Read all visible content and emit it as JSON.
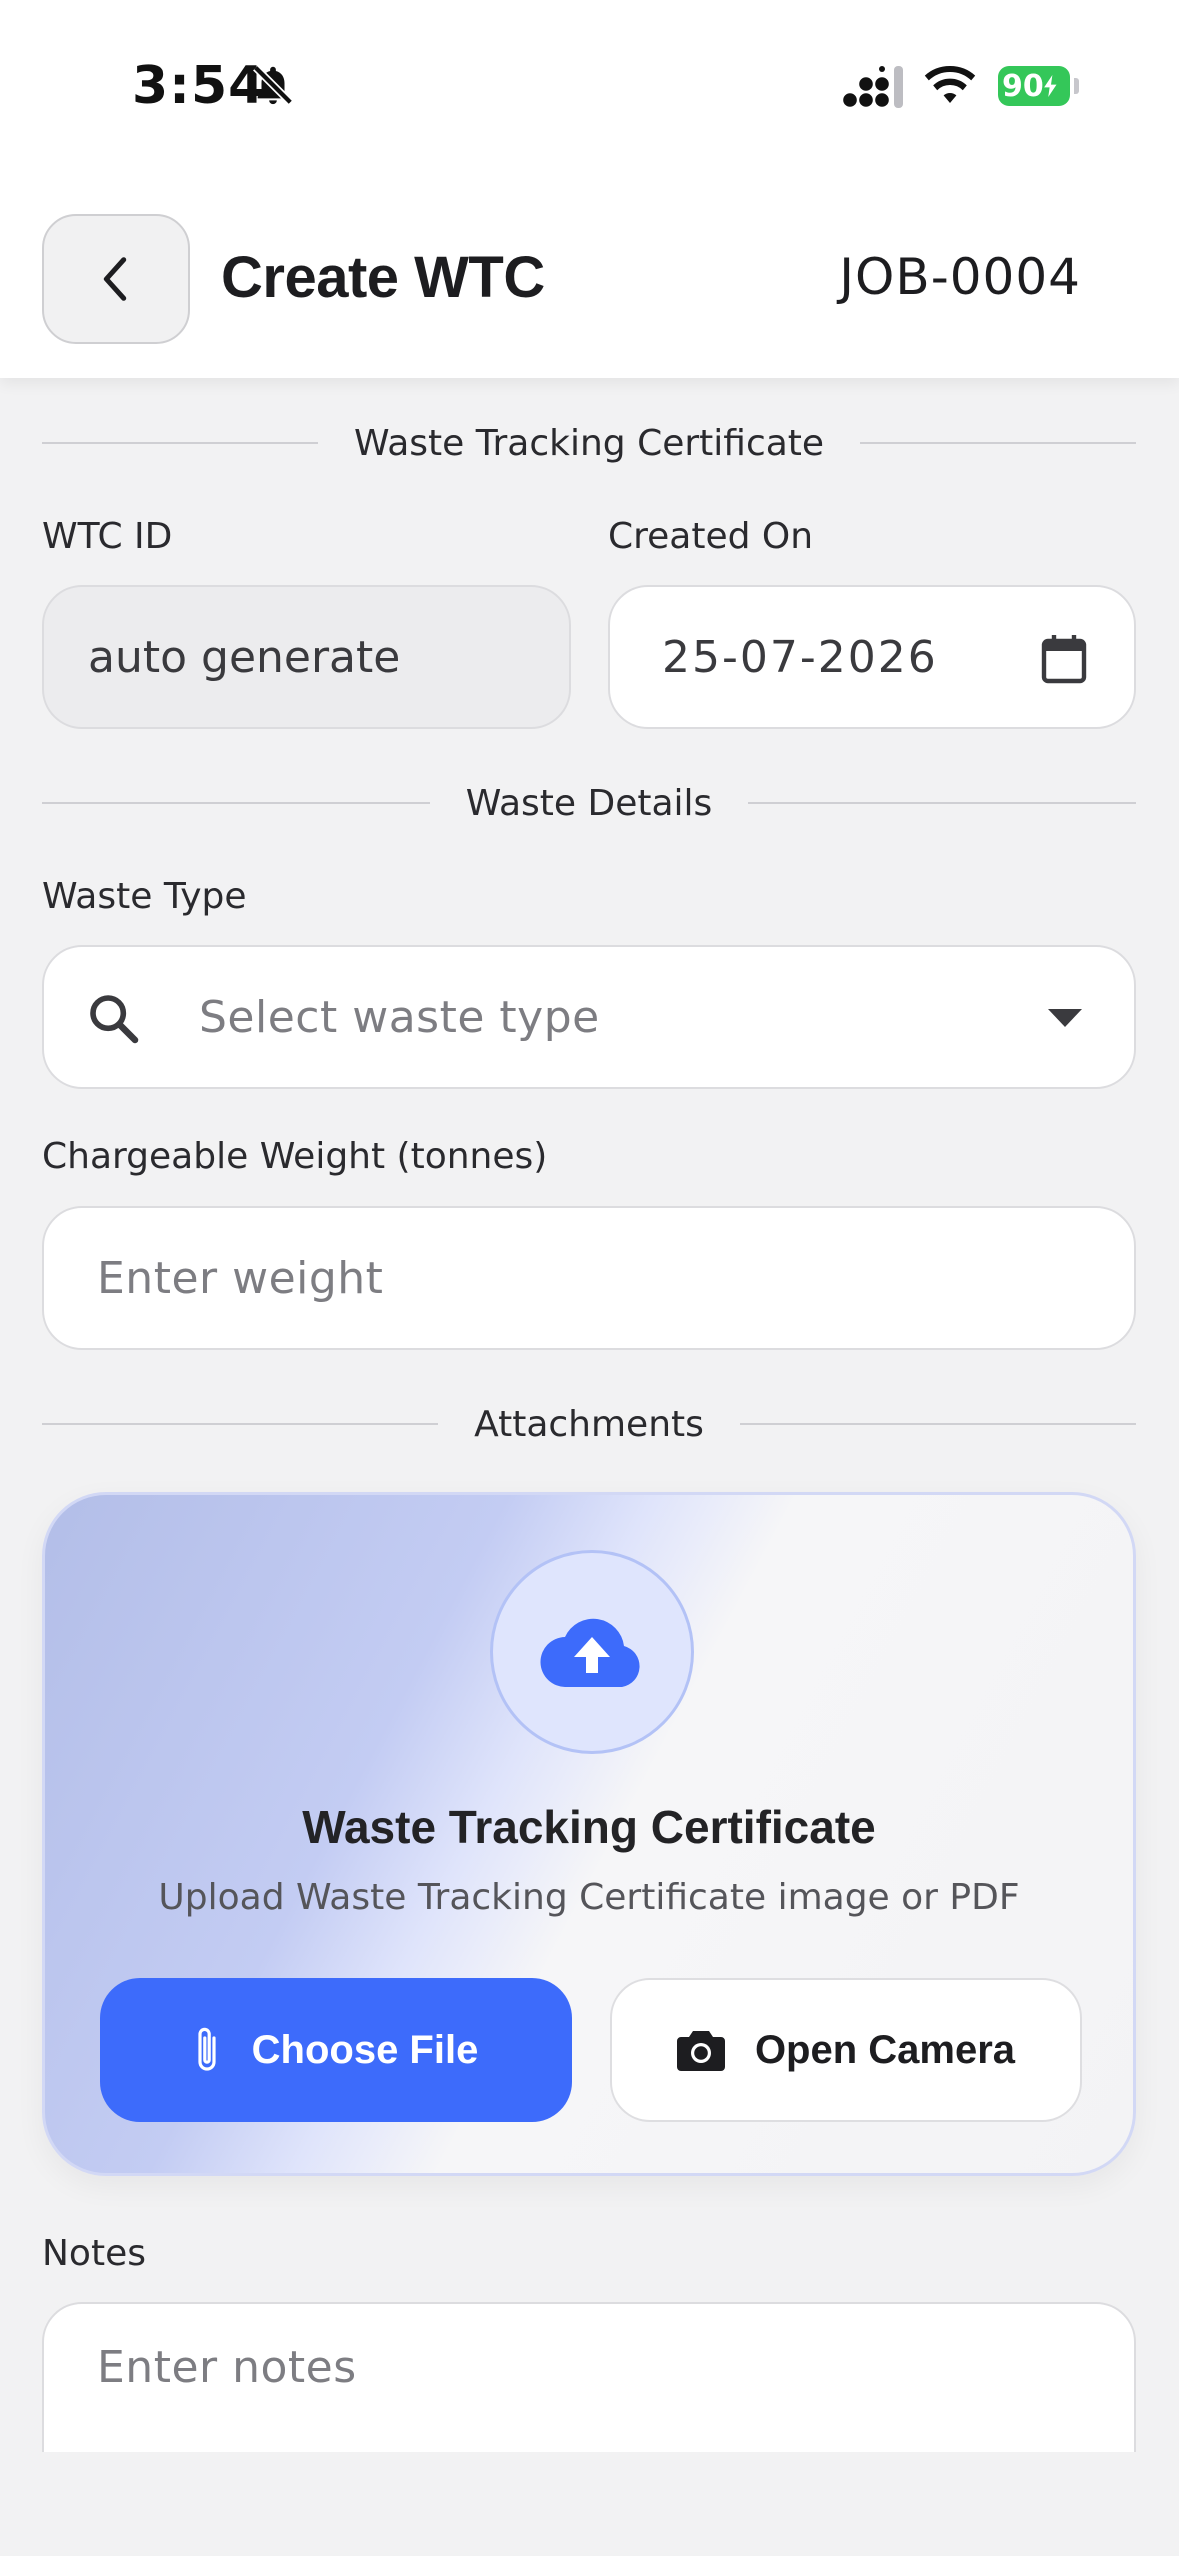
{
  "status_bar": {
    "time": "3:54",
    "battery": "90"
  },
  "header": {
    "title": "Create WTC",
    "job_id": "JOB-0004"
  },
  "sections": {
    "certificate": "Waste Tracking Certificate",
    "waste_details": "Waste Details",
    "attachments": "Attachments"
  },
  "form": {
    "wtc_id_label": "WTC ID",
    "wtc_id_value": "auto generate",
    "created_on_label": "Created On",
    "created_on_value": "25-07-2026",
    "waste_type_label": "Waste Type",
    "waste_type_placeholder": "Select waste type",
    "weight_label": "Chargeable Weight (tonnes)",
    "weight_placeholder": "Enter weight",
    "notes_label": "Notes",
    "notes_placeholder": "Enter notes"
  },
  "upload": {
    "title": "Waste Tracking Certificate",
    "subtitle": "Upload Waste Tracking Certificate image or PDF",
    "choose_file": "Choose File",
    "open_camera": "Open Camera"
  },
  "colors": {
    "accent": "#3d6bfb",
    "battery": "#34c759",
    "background": "#f2f2f3"
  },
  "icons": [
    "bell-slash-icon",
    "cellular-signal-icon",
    "wifi-icon",
    "battery-icon",
    "chevron-left-icon",
    "calendar-icon",
    "search-icon",
    "caret-down-icon",
    "cloud-upload-icon",
    "paperclip-icon",
    "camera-icon"
  ]
}
